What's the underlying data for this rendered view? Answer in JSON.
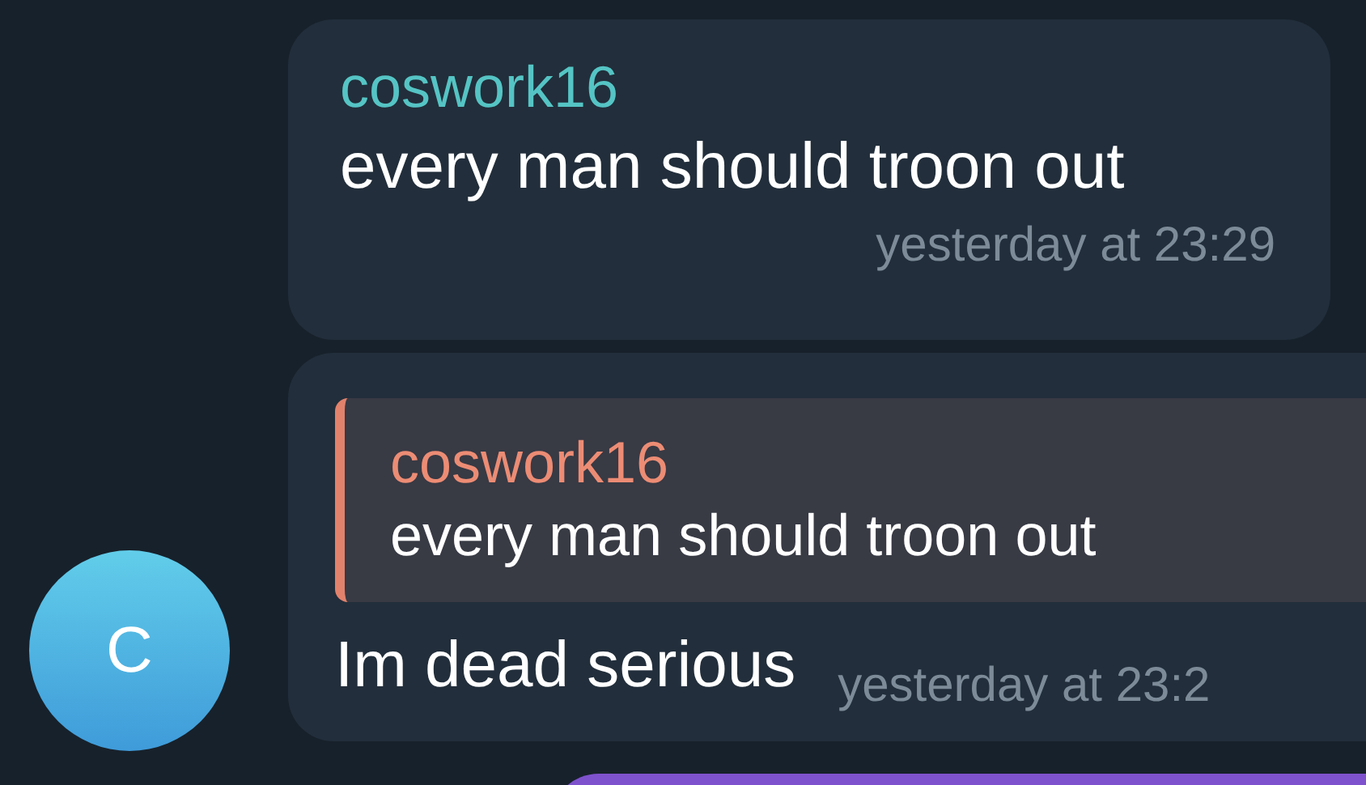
{
  "messages": [
    {
      "kind": "plain",
      "sender": "coswork16",
      "text": "every man should troon out",
      "time": "yesterday at 23:29"
    },
    {
      "kind": "reply",
      "avatar": "C",
      "reply_to": {
        "sender": "coswork16",
        "text": "every man should troon out"
      },
      "text": "Im dead serious",
      "time": "yesterday at 23:2"
    }
  ]
}
